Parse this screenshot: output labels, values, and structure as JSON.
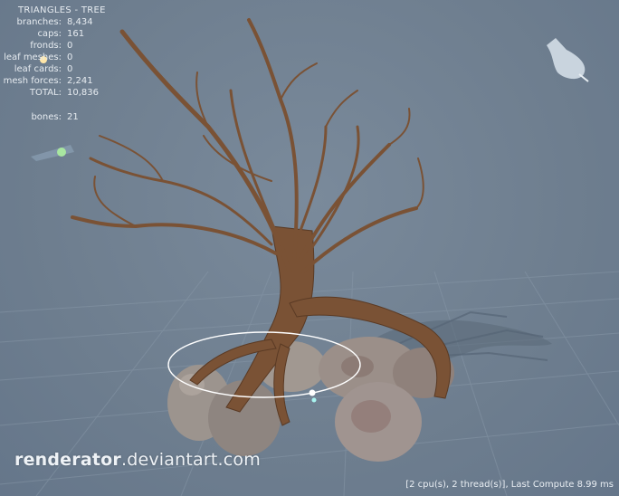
{
  "stats": {
    "title": "TRIANGLES - TREE",
    "rows": [
      {
        "label": "branches:",
        "value": "8,434"
      },
      {
        "label": "caps:",
        "value": "161"
      },
      {
        "label": "fronds:",
        "value": "0"
      },
      {
        "label": "leaf meshes:",
        "value": "0"
      },
      {
        "label": "leaf cards:",
        "value": "0"
      },
      {
        "label": "mesh forces:",
        "value": "2,241"
      },
      {
        "label": "TOTAL:",
        "value": "10,836"
      },
      {
        "label": "bones:",
        "value": "21"
      }
    ]
  },
  "watermark": {
    "brand": "renderator",
    "suffix": ".deviantart.com"
  },
  "status": {
    "text": "[2 cpu(s), 2 thread(s)], Last Compute 8.99 ms"
  },
  "colors": {
    "background": "#6f7f90",
    "grid": "#8a99a8",
    "bark": "#7a5235",
    "rock": "#a39a93",
    "ring": "#ffffff"
  },
  "icons": [
    "light-bulb-icon",
    "wind-gizmo-icon",
    "camera-gizmo-icon",
    "selection-ring-icon"
  ]
}
